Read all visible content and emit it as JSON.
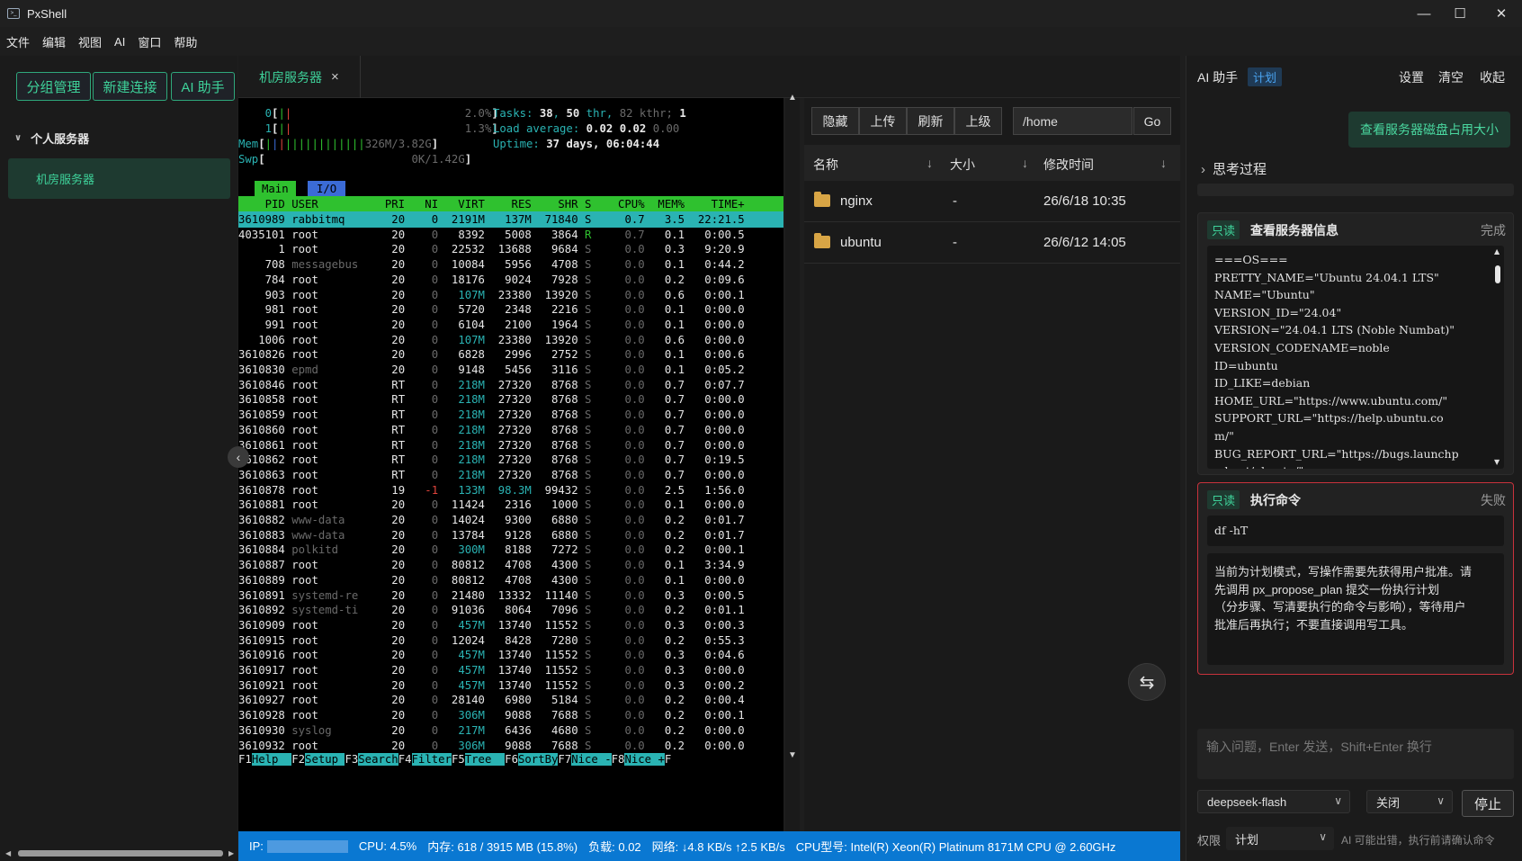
{
  "window": {
    "title": "PxShell",
    "icon": "app-icon",
    "controls": [
      "minimize-icon",
      "maximize-icon",
      "close-icon"
    ]
  },
  "menu": [
    "文件",
    "编辑",
    "视图",
    "AI",
    "窗口",
    "帮助"
  ],
  "sidebar": {
    "buttons": [
      "分组管理",
      "新建连接",
      "AI 助手"
    ],
    "group": "个人服务器",
    "items": [
      "机房服务器"
    ]
  },
  "tabs": [
    {
      "label": "机房服务器",
      "close": "×"
    }
  ],
  "terminal": {
    "cpu0_index": "0",
    "cpu0_pct": "2.0%",
    "cpu1_index": "1",
    "cpu1_pct": "1.3%",
    "mem_label": "Mem",
    "mem_val": "326M/3.82G",
    "swp_label": "Swp",
    "swp_val": "0K/1.42G",
    "tasks_label": "Tasks:",
    "tasks": "38",
    "thr_count": "50",
    "thr_label": "thr,",
    "kthr": "82 kthr;",
    "running": "1",
    "load_label": "Load average:",
    "load1": "0.02",
    "load5": "0.02",
    "load15": "0.00",
    "uptime_label": "Uptime:",
    "uptime": "37 days, 06:04:44",
    "tab_main": "Main",
    "tab_io": "I/O",
    "columns": [
      "PID",
      "USER",
      "PRI",
      "NI",
      "VIRT",
      "RES",
      "SHR",
      "S",
      "CPU%",
      "MEM%",
      "TIME+"
    ],
    "rows": [
      [
        "3610989",
        "rabbitmq",
        "20",
        "0",
        "2191M",
        "137M",
        "71840",
        "S",
        "0.7",
        "3.5",
        "22:21.5"
      ],
      [
        "4035101",
        "root",
        "20",
        "0",
        "8392",
        "5008",
        "3864",
        "R",
        "0.7",
        "0.1",
        "0:00.5"
      ],
      [
        "1",
        "root",
        "20",
        "0",
        "22532",
        "13688",
        "9684",
        "S",
        "0.0",
        "0.3",
        "9:20.9"
      ],
      [
        "708",
        "messagebus",
        "20",
        "0",
        "10084",
        "5956",
        "4708",
        "S",
        "0.0",
        "0.1",
        "0:44.2"
      ],
      [
        "784",
        "root",
        "20",
        "0",
        "18176",
        "9024",
        "7928",
        "S",
        "0.0",
        "0.2",
        "0:09.6"
      ],
      [
        "903",
        "root",
        "20",
        "0",
        "107M",
        "23380",
        "13920",
        "S",
        "0.0",
        "0.6",
        "0:00.1"
      ],
      [
        "981",
        "root",
        "20",
        "0",
        "5720",
        "2348",
        "2216",
        "S",
        "0.0",
        "0.1",
        "0:00.0"
      ],
      [
        "991",
        "root",
        "20",
        "0",
        "6104",
        "2100",
        "1964",
        "S",
        "0.0",
        "0.1",
        "0:00.0"
      ],
      [
        "1006",
        "root",
        "20",
        "0",
        "107M",
        "23380",
        "13920",
        "S",
        "0.0",
        "0.6",
        "0:00.0"
      ],
      [
        "3610826",
        "root",
        "20",
        "0",
        "6828",
        "2996",
        "2752",
        "S",
        "0.0",
        "0.1",
        "0:00.6"
      ],
      [
        "3610830",
        "epmd",
        "20",
        "0",
        "9148",
        "5456",
        "3116",
        "S",
        "0.0",
        "0.1",
        "0:05.2"
      ],
      [
        "3610846",
        "root",
        "RT",
        "0",
        "218M",
        "27320",
        "8768",
        "S",
        "0.0",
        "0.7",
        "0:07.7"
      ],
      [
        "3610858",
        "root",
        "RT",
        "0",
        "218M",
        "27320",
        "8768",
        "S",
        "0.0",
        "0.7",
        "0:00.0"
      ],
      [
        "3610859",
        "root",
        "RT",
        "0",
        "218M",
        "27320",
        "8768",
        "S",
        "0.0",
        "0.7",
        "0:00.0"
      ],
      [
        "3610860",
        "root",
        "RT",
        "0",
        "218M",
        "27320",
        "8768",
        "S",
        "0.0",
        "0.7",
        "0:00.0"
      ],
      [
        "3610861",
        "root",
        "RT",
        "0",
        "218M",
        "27320",
        "8768",
        "S",
        "0.0",
        "0.7",
        "0:00.0"
      ],
      [
        "3610862",
        "root",
        "RT",
        "0",
        "218M",
        "27320",
        "8768",
        "S",
        "0.0",
        "0.7",
        "0:19.5"
      ],
      [
        "3610863",
        "root",
        "RT",
        "0",
        "218M",
        "27320",
        "8768",
        "S",
        "0.0",
        "0.7",
        "0:00.0"
      ],
      [
        "3610878",
        "root",
        "19",
        "-1",
        "133M",
        "98.3M",
        "99432",
        "S",
        "0.0",
        "2.5",
        "1:56.0"
      ],
      [
        "3610881",
        "root",
        "20",
        "0",
        "11424",
        "2316",
        "1000",
        "S",
        "0.0",
        "0.1",
        "0:00.0"
      ],
      [
        "3610882",
        "www-data",
        "20",
        "0",
        "14024",
        "9300",
        "6880",
        "S",
        "0.0",
        "0.2",
        "0:01.7"
      ],
      [
        "3610883",
        "www-data",
        "20",
        "0",
        "13784",
        "9128",
        "6880",
        "S",
        "0.0",
        "0.2",
        "0:01.7"
      ],
      [
        "3610884",
        "polkitd",
        "20",
        "0",
        "300M",
        "8188",
        "7272",
        "S",
        "0.0",
        "0.2",
        "0:00.1"
      ],
      [
        "3610887",
        "root",
        "20",
        "0",
        "80812",
        "4708",
        "4300",
        "S",
        "0.0",
        "0.1",
        "3:34.9"
      ],
      [
        "3610889",
        "root",
        "20",
        "0",
        "80812",
        "4708",
        "4300",
        "S",
        "0.0",
        "0.1",
        "0:00.0"
      ],
      [
        "3610891",
        "systemd-re",
        "20",
        "0",
        "21480",
        "13332",
        "11140",
        "S",
        "0.0",
        "0.3",
        "0:00.5"
      ],
      [
        "3610892",
        "systemd-ti",
        "20",
        "0",
        "91036",
        "8064",
        "7096",
        "S",
        "0.0",
        "0.2",
        "0:01.1"
      ],
      [
        "3610909",
        "root",
        "20",
        "0",
        "457M",
        "13740",
        "11552",
        "S",
        "0.0",
        "0.3",
        "0:00.3"
      ],
      [
        "3610915",
        "root",
        "20",
        "0",
        "12024",
        "8428",
        "7280",
        "S",
        "0.0",
        "0.2",
        "0:55.3"
      ],
      [
        "3610916",
        "root",
        "20",
        "0",
        "457M",
        "13740",
        "11552",
        "S",
        "0.0",
        "0.3",
        "0:04.6"
      ],
      [
        "3610917",
        "root",
        "20",
        "0",
        "457M",
        "13740",
        "11552",
        "S",
        "0.0",
        "0.3",
        "0:00.0"
      ],
      [
        "3610921",
        "root",
        "20",
        "0",
        "457M",
        "13740",
        "11552",
        "S",
        "0.0",
        "0.3",
        "0:00.2"
      ],
      [
        "3610927",
        "root",
        "20",
        "0",
        "28140",
        "6980",
        "5184",
        "S",
        "0.0",
        "0.2",
        "0:00.4"
      ],
      [
        "3610928",
        "root",
        "20",
        "0",
        "306M",
        "9088",
        "7688",
        "S",
        "0.0",
        "0.2",
        "0:00.1"
      ],
      [
        "3610930",
        "syslog",
        "20",
        "0",
        "217M",
        "6436",
        "4680",
        "S",
        "0.0",
        "0.2",
        "0:00.0"
      ],
      [
        "3610932",
        "root",
        "20",
        "0",
        "306M",
        "9088",
        "7688",
        "S",
        "0.0",
        "0.2",
        "0:00.0"
      ]
    ],
    "fkeys": [
      {
        "key": "F1",
        "label": "Help  "
      },
      {
        "key": "F2",
        "label": "Setup "
      },
      {
        "key": "F3",
        "label": "Search"
      },
      {
        "key": "F4",
        "label": "Filter"
      },
      {
        "key": "F5",
        "label": "Tree  "
      },
      {
        "key": "F6",
        "label": "SortBy"
      },
      {
        "key": "F7",
        "label": "Nice -"
      },
      {
        "key": "F8",
        "label": "Nice +"
      },
      {
        "key": "F",
        "label": ""
      }
    ]
  },
  "files": {
    "buttons": [
      "隐藏",
      "上传",
      "刷新",
      "上级"
    ],
    "path": "/home",
    "go": "Go",
    "columns": [
      "名称",
      "大小",
      "修改时间"
    ],
    "rows": [
      {
        "name": "nginx",
        "size": "-",
        "mtime": "26/6/18 10:35"
      },
      {
        "name": "ubuntu",
        "size": "-",
        "mtime": "26/6/12 14:05"
      }
    ]
  },
  "status": {
    "ip_label": "IP:",
    "cpu": "CPU: 4.5%",
    "mem": "内存: 618 / 3915 MB (15.8%)",
    "load": "负载: 0.02",
    "net": "网络: ↓4.8 KB/s ↑2.5 KB/s",
    "cpu_model": "CPU型号: Intel(R) Xeon(R) Platinum 8171M CPU @ 2.60GHz"
  },
  "ai": {
    "title": "AI 助手",
    "mode_badge": "计划",
    "header_buttons": [
      "设置",
      "清空",
      "收起"
    ],
    "user_message": "查看服务器磁盘占用大小",
    "thinking": "思考过程",
    "card1": {
      "badge": "只读",
      "title": "查看服务器信息",
      "state": "完成",
      "lines": [
        "===OS===",
        "PRETTY_NAME=\"Ubuntu 24.04.1 LTS\"",
        "NAME=\"Ubuntu\"",
        "VERSION_ID=\"24.04\"",
        "VERSION=\"24.04.1 LTS (Noble Numbat)\"",
        "VERSION_CODENAME=noble",
        "ID=ubuntu",
        "ID_LIKE=debian",
        "HOME_URL=\"https://www.ubuntu.com/\"",
        "SUPPORT_URL=\"https://help.ubuntu.co",
        "m/\"",
        "BUG_REPORT_URL=\"https://bugs.launchp",
        "ad.net/ubuntu/\""
      ]
    },
    "card2": {
      "badge": "只读",
      "title": "执行命令",
      "state": "失败",
      "command": "df -hT",
      "message_lines": [
        "当前为计划模式，写操作需要先获得用户批准。请",
        "先调用 px_propose_plan 提交一份执行计划",
        "（分步骤、写清要执行的命令与影响），等待用户",
        "批准后再执行；不要直接调用写工具。"
      ]
    },
    "input_placeholder": "输入问题，Enter 发送，Shift+Enter 换行",
    "model": "deepseek-flash",
    "toggle": "关闭",
    "stop": "停止",
    "perm_label": "权限",
    "perm_value": "计划",
    "perm_hint": "AI 可能出错，执行前请确认命令"
  }
}
